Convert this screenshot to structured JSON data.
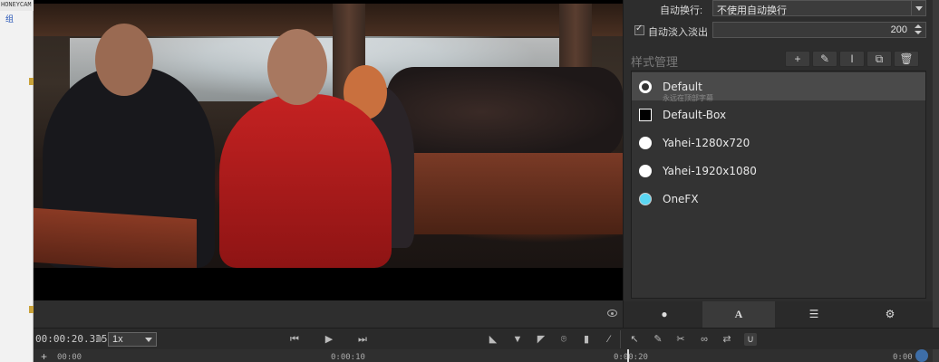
{
  "background_window": {
    "title": "HONEYCAM",
    "label": "组"
  },
  "panel": {
    "auto_wrap_label": "自动换行:",
    "auto_wrap_value": "不使用自动换行",
    "fade_checkbox_label": "自动淡入淡出",
    "fade_value": "200",
    "section_title": "样式管理",
    "toolbar": {
      "add_glyph": "+",
      "edit_glyph": "✎",
      "text_glyph": "I",
      "copy_glyph": "⧉",
      "delete_glyph": "🗑"
    },
    "styles": [
      {
        "name": "Default",
        "sub": "永远在顶部字幕",
        "swatch": "ring",
        "selected": true
      },
      {
        "name": "Default-Box",
        "swatch": "box",
        "selected": false
      },
      {
        "name": "Yahei-1280x720",
        "swatch": "white",
        "selected": false
      },
      {
        "name": "Yahei-1920x1080",
        "swatch": "white",
        "selected": false
      },
      {
        "name": "OneFX",
        "swatch": "cyan",
        "selected": false
      }
    ],
    "tabs": [
      {
        "icon": "speech-bubble-icon",
        "glyph": "●"
      },
      {
        "icon": "font-icon",
        "glyph": "A"
      },
      {
        "icon": "list-icon",
        "glyph": "☰"
      },
      {
        "icon": "gear-icon",
        "glyph": "⚙"
      }
    ]
  },
  "transport": {
    "timecode": "00:00:20.325",
    "speed": "1x",
    "prev_glyph": "⏮",
    "play_glyph": "▶",
    "next_glyph": "⏭"
  },
  "ruler": {
    "ticks": [
      "00:00",
      "0:00:10",
      "0:00:20",
      "0:00"
    ]
  },
  "colors": {
    "accent_cyan": "#5ad6f2",
    "panel_bg": "#2d2d2d",
    "globe": "#3e6ea8"
  }
}
